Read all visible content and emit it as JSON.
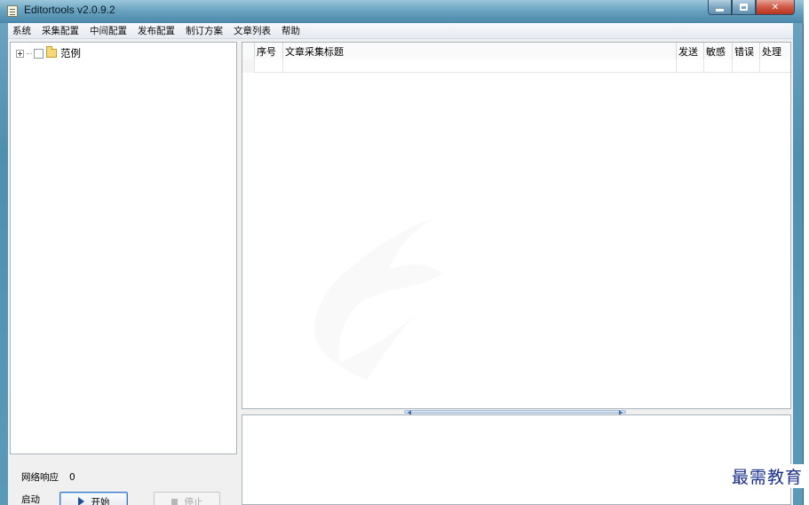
{
  "window": {
    "title": "Editortools v2.0.9.2"
  },
  "menu": {
    "items": [
      "系统",
      "采集配置",
      "中间配置",
      "发布配置",
      "制订方案",
      "文章列表",
      "帮助"
    ]
  },
  "tree": {
    "root_label": "范例"
  },
  "status": {
    "network_label": "网络响应",
    "network_value": "0"
  },
  "controls": {
    "start_row_label": "启动",
    "start_button": "开始",
    "stop_button": "停止"
  },
  "table": {
    "columns": [
      "序号",
      "文章采集标题",
      "发送",
      "敏感",
      "错误",
      "处理"
    ]
  },
  "brand": {
    "text": "最需教育"
  }
}
